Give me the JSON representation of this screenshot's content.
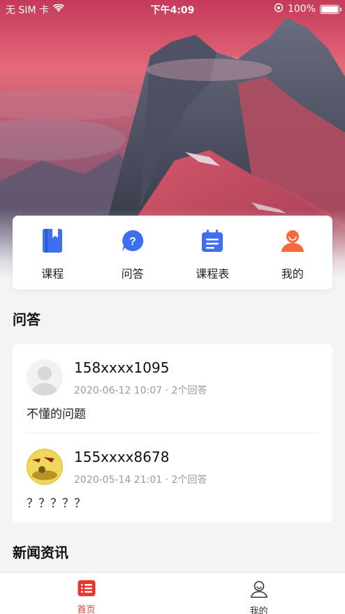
{
  "status_bar": {
    "carrier": "无 SIM 卡",
    "time": "下午4:09",
    "battery": "100%"
  },
  "nav": {
    "items": [
      {
        "label": "课程",
        "icon": "book-icon",
        "color": "#3d6ff0"
      },
      {
        "label": "问答",
        "icon": "question-bubble-icon",
        "color": "#3d6ff0"
      },
      {
        "label": "课程表",
        "icon": "calendar-icon",
        "color": "#3d6ff0"
      },
      {
        "label": "我的",
        "icon": "user-icon",
        "color": "#f56a3d"
      }
    ]
  },
  "qa": {
    "title": "问答",
    "items": [
      {
        "user": "158xxxx1095",
        "date": "2020-06-12 10:07",
        "answers": "2个回答",
        "question": "不懂的问题",
        "avatar": "default-avatar"
      },
      {
        "user": "155xxxx8678",
        "date": "2020-05-14 21:01",
        "answers": "2个回答",
        "question": "？？？？？",
        "avatar": "custom-avatar"
      }
    ],
    "separator": "·"
  },
  "news": {
    "title": "新闻资讯"
  },
  "tabbar": {
    "tabs": [
      {
        "label": "首页",
        "icon": "home-list-icon",
        "active": true
      },
      {
        "label": "我的",
        "icon": "profile-icon",
        "active": false
      }
    ],
    "active_color": "#e8342c"
  }
}
